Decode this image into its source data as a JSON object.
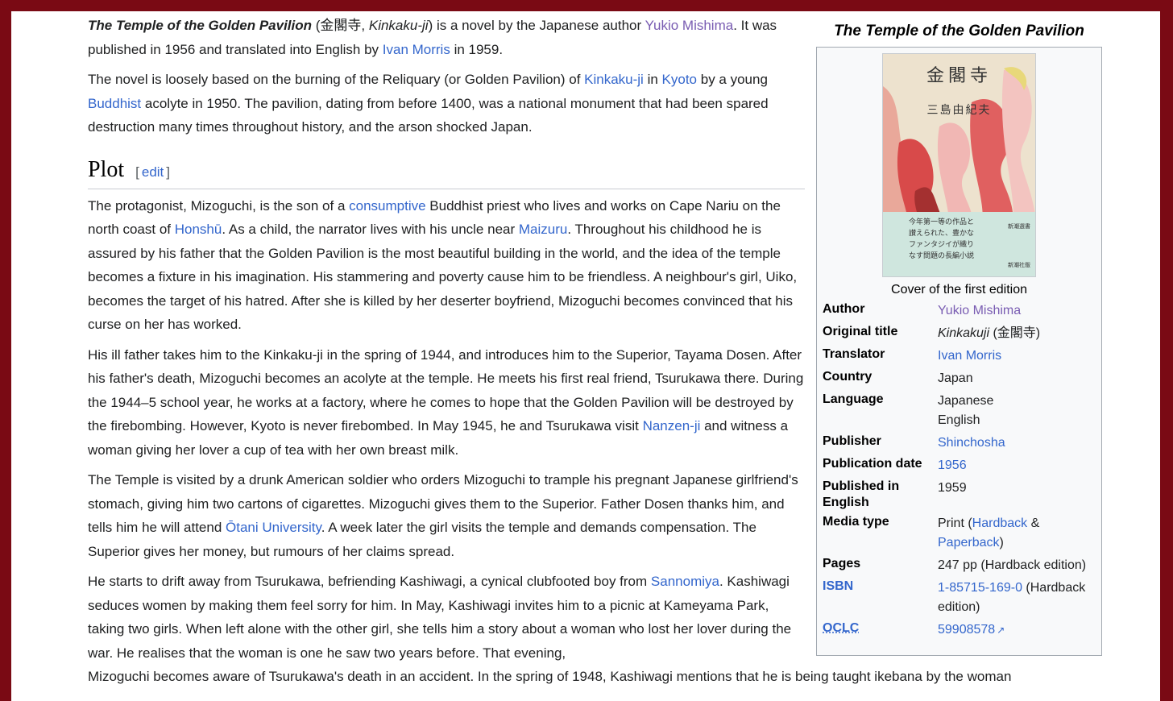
{
  "intro": {
    "title_italic": "The Temple of the Golden Pavilion",
    "after_title": " (金閣寺, ",
    "kinkakuji_italic": "Kinkaku-ji",
    "after_kinkakuji": ") is a novel by the Japanese author ",
    "author_link": "Yukio Mishima",
    "after_author": ". It was published in 1956 and translated into English by ",
    "translator_link": "Ivan Morris",
    "after_translator": " in 1959."
  },
  "para2": {
    "t1": "The novel is loosely based on the burning of the Reliquary (or Golden Pavilion) of ",
    "l1": "Kinkaku-ji",
    "t2": " in ",
    "l2": "Kyoto",
    "t3": " by a young ",
    "l3": "Buddhist",
    "t4": " acolyte in 1950. The pavilion, dating from before 1400, was a national monument that had been spared destruction many times throughout history, and the arson shocked Japan."
  },
  "plot": {
    "heading": "Plot",
    "edit_label": "edit",
    "bracket_open": "[",
    "bracket_close": "]"
  },
  "plot_p1": {
    "t1": "The protagonist, Mizoguchi, is the son of a ",
    "l1": "consumptive",
    "t2": " Buddhist priest who lives and works on Cape Nariu on the north coast of ",
    "l2": "Honshū",
    "t3": ". As a child, the narrator lives with his uncle near ",
    "l3": "Maizuru",
    "t4": ". Throughout his childhood he is assured by his father that the Golden Pavilion is the most beautiful building in the world, and the idea of the temple becomes a fixture in his imagination. His stammering and poverty cause him to be friendless. A neighbour's girl, Uiko, becomes the target of his hatred. After she is killed by her deserter boyfriend, Mizoguchi becomes convinced that his curse on her has worked."
  },
  "plot_p2": {
    "t1": "His ill father takes him to the Kinkaku-ji in the spring of 1944, and introduces him to the Superior, Tayama Dosen. After his father's death, Mizoguchi becomes an acolyte at the temple. He meets his first real friend, Tsurukawa there. During the 1944–5 school year, he works at a factory, where he comes to hope that the Golden Pavilion will be destroyed by the firebombing. However, Kyoto is never firebombed. In May 1945, he and Tsurukawa visit ",
    "l1": "Nanzen-ji",
    "t2": " and witness a woman giving her lover a cup of tea with her own breast milk."
  },
  "plot_p3": {
    "t1": "The Temple is visited by a drunk American soldier who orders Mizoguchi to trample his pregnant Japanese girlfriend's stomach, giving him two cartons of cigarettes. Mizoguchi gives them to the Superior. Father Dosen thanks him, and tells him he will attend ",
    "l1": "Ōtani University",
    "t2": ". A week later the girl visits the temple and demands compensation. The Superior gives her money, but rumours of her claims spread."
  },
  "plot_p4": {
    "t1": "He starts to drift away from Tsurukawa, befriending Kashiwagi, a cynical clubfooted boy from ",
    "l1": "Sannomiya",
    "t2": ". Kashiwagi seduces women by making them feel sorry for him. In May, Kashiwagi invites him to a picnic at Kameyama Park, taking two girls. When left alone with the other girl, she tells him a story about a woman who lost her lover during the war. He realises that the woman is one he saw two years before. That evening,",
    "t3": "Mizoguchi becomes aware of Tsurukawa's death in an accident. In the spring of 1948, Kashiwagi mentions that he is being taught ikebana by the woman"
  },
  "infobox": {
    "caption": "The Temple of the Golden Pavilion",
    "image_caption": "Cover of the first edition",
    "cover": {
      "title": "金閣寺",
      "author": "三島由紀夫",
      "blurb": "今年第一等の作品と\n讃えられた、豊かな\nファンタジイが織り\nなす問題の長編小説",
      "publisher_mark": "新潮選書",
      "publisher_mark2": "新潮社版"
    },
    "rows": [
      {
        "label": "Author",
        "value": "Yukio Mishima",
        "link": true,
        "visited": true
      },
      {
        "label": "Original title",
        "value_italic": "Kinkakuji",
        "value_rest": " (金閣寺)"
      },
      {
        "label": "Translator",
        "value": "Ivan Morris",
        "link": true
      },
      {
        "label": "Country",
        "value": "Japan"
      },
      {
        "label": "Language",
        "value": "Japanese",
        "value2": "English"
      },
      {
        "label": "Publisher",
        "value": "Shinchosha",
        "link": true
      },
      {
        "label": "Publication date",
        "value": "1956",
        "link": true
      },
      {
        "label": "Published in English",
        "value": "1959"
      },
      {
        "label": "Media type",
        "value_pre": "Print (",
        "link1": "Hardback",
        "value_mid": " &",
        "link2": "Paperback",
        "value_post": ")"
      },
      {
        "label": "Pages",
        "value": "247 pp (Hardback edition)"
      },
      {
        "label": "ISBN",
        "link_value": "1-85715-169-0",
        "value_rest": " (Hardback edition)"
      },
      {
        "label": "OCLC",
        "link_value": "59908578"
      }
    ]
  },
  "colors": {
    "frame": "#7a0a14",
    "link": "#3366cc",
    "visited_link": "#795cb2",
    "infobox_bg": "#f8f9fa",
    "infobox_border": "#a2a9b1"
  }
}
